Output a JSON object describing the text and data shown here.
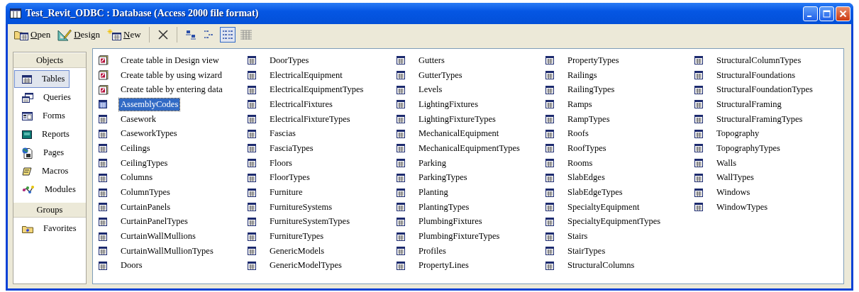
{
  "window": {
    "title": "Test_Revit_ODBC : Database (Access 2000 file format)"
  },
  "toolbar": {
    "buttons": [
      {
        "label": "Open",
        "kind": "open"
      },
      {
        "label": "Design",
        "kind": "design"
      },
      {
        "label": "New",
        "kind": "new"
      }
    ],
    "view_buttons": [
      {
        "kind": "large",
        "selected": false
      },
      {
        "kind": "small",
        "selected": false
      },
      {
        "kind": "list",
        "selected": true
      },
      {
        "kind": "details",
        "selected": false
      }
    ]
  },
  "sidebar": {
    "sections": [
      {
        "title": "Objects",
        "items": [
          {
            "label": "Tables",
            "kind": "tables",
            "selected": true
          },
          {
            "label": "Queries",
            "kind": "queries",
            "selected": false
          },
          {
            "label": "Forms",
            "kind": "forms",
            "selected": false
          },
          {
            "label": "Reports",
            "kind": "reports",
            "selected": false
          },
          {
            "label": "Pages",
            "kind": "pages",
            "selected": false
          },
          {
            "label": "Macros",
            "kind": "macros",
            "selected": false
          },
          {
            "label": "Modules",
            "kind": "modules",
            "selected": false
          }
        ]
      },
      {
        "title": "Groups",
        "items": [
          {
            "label": "Favorites",
            "kind": "favorites",
            "selected": false
          }
        ]
      }
    ]
  },
  "objects": [
    {
      "label": "Create table in Design view",
      "kind": "shortcut",
      "selected": false
    },
    {
      "label": "Create table by using wizard",
      "kind": "shortcut",
      "selected": false
    },
    {
      "label": "Create table by entering data",
      "kind": "shortcut",
      "selected": false
    },
    {
      "label": "AssemblyCodes",
      "kind": "table",
      "selected": true
    },
    {
      "label": "Casework",
      "kind": "table",
      "selected": false
    },
    {
      "label": "CaseworkTypes",
      "kind": "table",
      "selected": false
    },
    {
      "label": "Ceilings",
      "kind": "table",
      "selected": false
    },
    {
      "label": "CeilingTypes",
      "kind": "table",
      "selected": false
    },
    {
      "label": "Columns",
      "kind": "table",
      "selected": false
    },
    {
      "label": "ColumnTypes",
      "kind": "table",
      "selected": false
    },
    {
      "label": "CurtainPanels",
      "kind": "table",
      "selected": false
    },
    {
      "label": "CurtainPanelTypes",
      "kind": "table",
      "selected": false
    },
    {
      "label": "CurtainWallMullions",
      "kind": "table",
      "selected": false
    },
    {
      "label": "CurtainWallMullionTypes",
      "kind": "table",
      "selected": false
    },
    {
      "label": "Doors",
      "kind": "table",
      "selected": false
    },
    {
      "label": "DoorTypes",
      "kind": "table",
      "selected": false
    },
    {
      "label": "ElectricalEquipment",
      "kind": "table",
      "selected": false
    },
    {
      "label": "ElectricalEquipmentTypes",
      "kind": "table",
      "selected": false
    },
    {
      "label": "ElectricalFixtures",
      "kind": "table",
      "selected": false
    },
    {
      "label": "ElectricalFixtureTypes",
      "kind": "table",
      "selected": false
    },
    {
      "label": "Fascias",
      "kind": "table",
      "selected": false
    },
    {
      "label": "FasciaTypes",
      "kind": "table",
      "selected": false
    },
    {
      "label": "Floors",
      "kind": "table",
      "selected": false
    },
    {
      "label": "FloorTypes",
      "kind": "table",
      "selected": false
    },
    {
      "label": "Furniture",
      "kind": "table",
      "selected": false
    },
    {
      "label": "FurnitureSystems",
      "kind": "table",
      "selected": false
    },
    {
      "label": "FurnitureSystemTypes",
      "kind": "table",
      "selected": false
    },
    {
      "label": "FurnitureTypes",
      "kind": "table",
      "selected": false
    },
    {
      "label": "GenericModels",
      "kind": "table",
      "selected": false
    },
    {
      "label": "GenericModelTypes",
      "kind": "table",
      "selected": false
    },
    {
      "label": "Gutters",
      "kind": "table",
      "selected": false
    },
    {
      "label": "GutterTypes",
      "kind": "table",
      "selected": false
    },
    {
      "label": "Levels",
      "kind": "table",
      "selected": false
    },
    {
      "label": "LightingFixtures",
      "kind": "table",
      "selected": false
    },
    {
      "label": "LightingFixtureTypes",
      "kind": "table",
      "selected": false
    },
    {
      "label": "MechanicalEquipment",
      "kind": "table",
      "selected": false
    },
    {
      "label": "MechanicalEquipmentTypes",
      "kind": "table",
      "selected": false
    },
    {
      "label": "Parking",
      "kind": "table",
      "selected": false
    },
    {
      "label": "ParkingTypes",
      "kind": "table",
      "selected": false
    },
    {
      "label": "Planting",
      "kind": "table",
      "selected": false
    },
    {
      "label": "PlantingTypes",
      "kind": "table",
      "selected": false
    },
    {
      "label": "PlumbingFixtures",
      "kind": "table",
      "selected": false
    },
    {
      "label": "PlumbingFixtureTypes",
      "kind": "table",
      "selected": false
    },
    {
      "label": "Profiles",
      "kind": "table",
      "selected": false
    },
    {
      "label": "PropertyLines",
      "kind": "table",
      "selected": false
    },
    {
      "label": "PropertyTypes",
      "kind": "table",
      "selected": false
    },
    {
      "label": "Railings",
      "kind": "table",
      "selected": false
    },
    {
      "label": "RailingTypes",
      "kind": "table",
      "selected": false
    },
    {
      "label": "Ramps",
      "kind": "table",
      "selected": false
    },
    {
      "label": "RampTypes",
      "kind": "table",
      "selected": false
    },
    {
      "label": "Roofs",
      "kind": "table",
      "selected": false
    },
    {
      "label": "RoofTypes",
      "kind": "table",
      "selected": false
    },
    {
      "label": "Rooms",
      "kind": "table",
      "selected": false
    },
    {
      "label": "SlabEdges",
      "kind": "table",
      "selected": false
    },
    {
      "label": "SlabEdgeTypes",
      "kind": "table",
      "selected": false
    },
    {
      "label": "SpecialtyEquipment",
      "kind": "table",
      "selected": false
    },
    {
      "label": "SpecialtyEquipmentTypes",
      "kind": "table",
      "selected": false
    },
    {
      "label": "Stairs",
      "kind": "table",
      "selected": false
    },
    {
      "label": "StairTypes",
      "kind": "table",
      "selected": false
    },
    {
      "label": "StructuralColumns",
      "kind": "table",
      "selected": false
    },
    {
      "label": "StructuralColumnTypes",
      "kind": "table",
      "selected": false
    },
    {
      "label": "StructuralFoundations",
      "kind": "table",
      "selected": false
    },
    {
      "label": "StructuralFoundationTypes",
      "kind": "table",
      "selected": false
    },
    {
      "label": "StructuralFraming",
      "kind": "table",
      "selected": false
    },
    {
      "label": "StructuralFramingTypes",
      "kind": "table",
      "selected": false
    },
    {
      "label": "Topography",
      "kind": "table",
      "selected": false
    },
    {
      "label": "TopographyTypes",
      "kind": "table",
      "selected": false
    },
    {
      "label": "Walls",
      "kind": "table",
      "selected": false
    },
    {
      "label": "WallTypes",
      "kind": "table",
      "selected": false
    },
    {
      "label": "Windows",
      "kind": "table",
      "selected": false
    },
    {
      "label": "WindowTypes",
      "kind": "table",
      "selected": false
    }
  ]
}
